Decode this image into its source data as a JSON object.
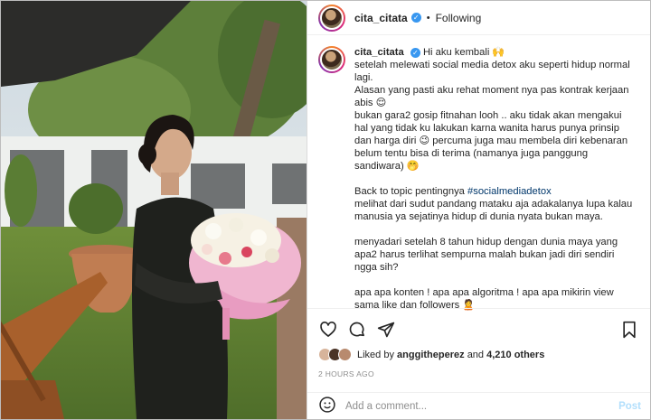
{
  "post_header": {
    "username": "cita_citata",
    "separator": "•",
    "follow_status": "Following"
  },
  "caption": {
    "username": "cita_citata",
    "paragraphs": [
      "Hi aku kembali 🙌",
      "setelah melewati social media detox aku seperti hidup normal lagi.",
      "Alasan yang pasti aku rehat moment nya pas kontrak kerjaan abis 😌",
      "bukan gara2 gosip fitnahan looh .. aku tidak akan mengakui hal yang tidak ku lakukan karna wanita harus punya prinsip dan harga diri 😉 percuma juga mau membela diri kebenaran belum tentu bisa di terima (namanya juga panggung sandiwara) 🤭",
      "Back to topic pentingnya",
      "#socialmediadetox",
      "melihat dari sudut pandang mataku aja adakalanya lupa kalau manusia ya sejatinya hidup di dunia nyata bukan maya.",
      "menyadari setelah 8 tahun hidup dengan dunia maya yang apa2 harus terlihat sempurna malah bukan jadi diri sendiri ngga sih?",
      "apa apa konten ! apa apa algoritma ! apa apa mikirin view sama like dan followers 🙎"
    ]
  },
  "likes": {
    "prefix": "Liked by",
    "user": "anggitheperez",
    "connector": "and",
    "count": "4,210 others"
  },
  "timestamp": "2 HOURS AGO",
  "comment_box": {
    "placeholder": "Add a comment...",
    "post_label": "Post"
  },
  "icons": {
    "like": "heart-icon",
    "comment": "comment-icon",
    "share": "share-icon",
    "save": "bookmark-icon",
    "emoji": "emoji-icon",
    "verified": "verified-badge-icon"
  },
  "colors": {
    "hashtag": "#00376b",
    "verified": "#3897f0",
    "post_button_disabled": "#b2dffc",
    "muted_text": "#8e8e8e"
  }
}
